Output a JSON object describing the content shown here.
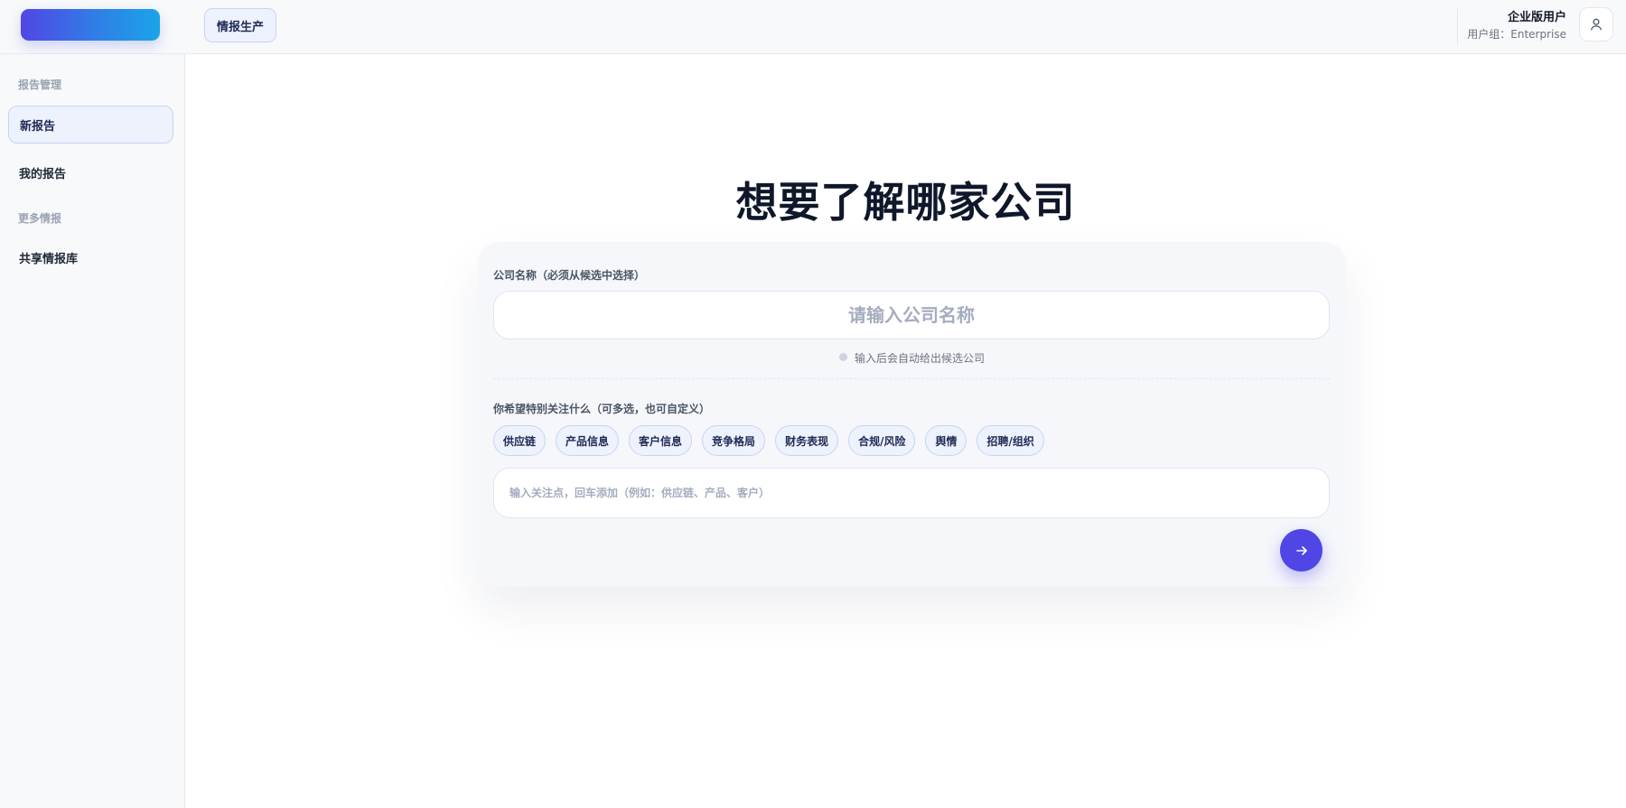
{
  "header": {
    "nav_tab": "情报生产",
    "user_name": "企业版用户",
    "user_group": "用户组：Enterprise"
  },
  "sidebar": {
    "section_reports": "报告管理",
    "items_reports": [
      {
        "label": "新报告",
        "active": true
      },
      {
        "label": "我的报告",
        "active": false
      }
    ],
    "section_more": "更多情报",
    "items_more": [
      {
        "label": "共享情报库",
        "active": false
      }
    ]
  },
  "main": {
    "title": "想要了解哪家公司",
    "company_label": "公司名称（必须从候选中选择）",
    "company_placeholder": "请输入公司名称",
    "company_value": "",
    "hint": "输入后会自动给出候选公司",
    "focus_label": "你希望特别关注什么（可多选，也可自定义）",
    "focus_tags": [
      "供应链",
      "产品信息",
      "客户信息",
      "竞争格局",
      "财务表现",
      "合规/风险",
      "舆情",
      "招聘/组织"
    ],
    "focus_placeholder": "输入关注点，回车添加（例如：供应链、产品、客户）",
    "focus_value": ""
  },
  "colors": {
    "accent": "#4f46e5",
    "chip_bg": "#eef2fd",
    "chip_border": "#c9d3f2"
  },
  "icons": {
    "avatar": "user-icon",
    "submit": "arrow-right-icon"
  }
}
